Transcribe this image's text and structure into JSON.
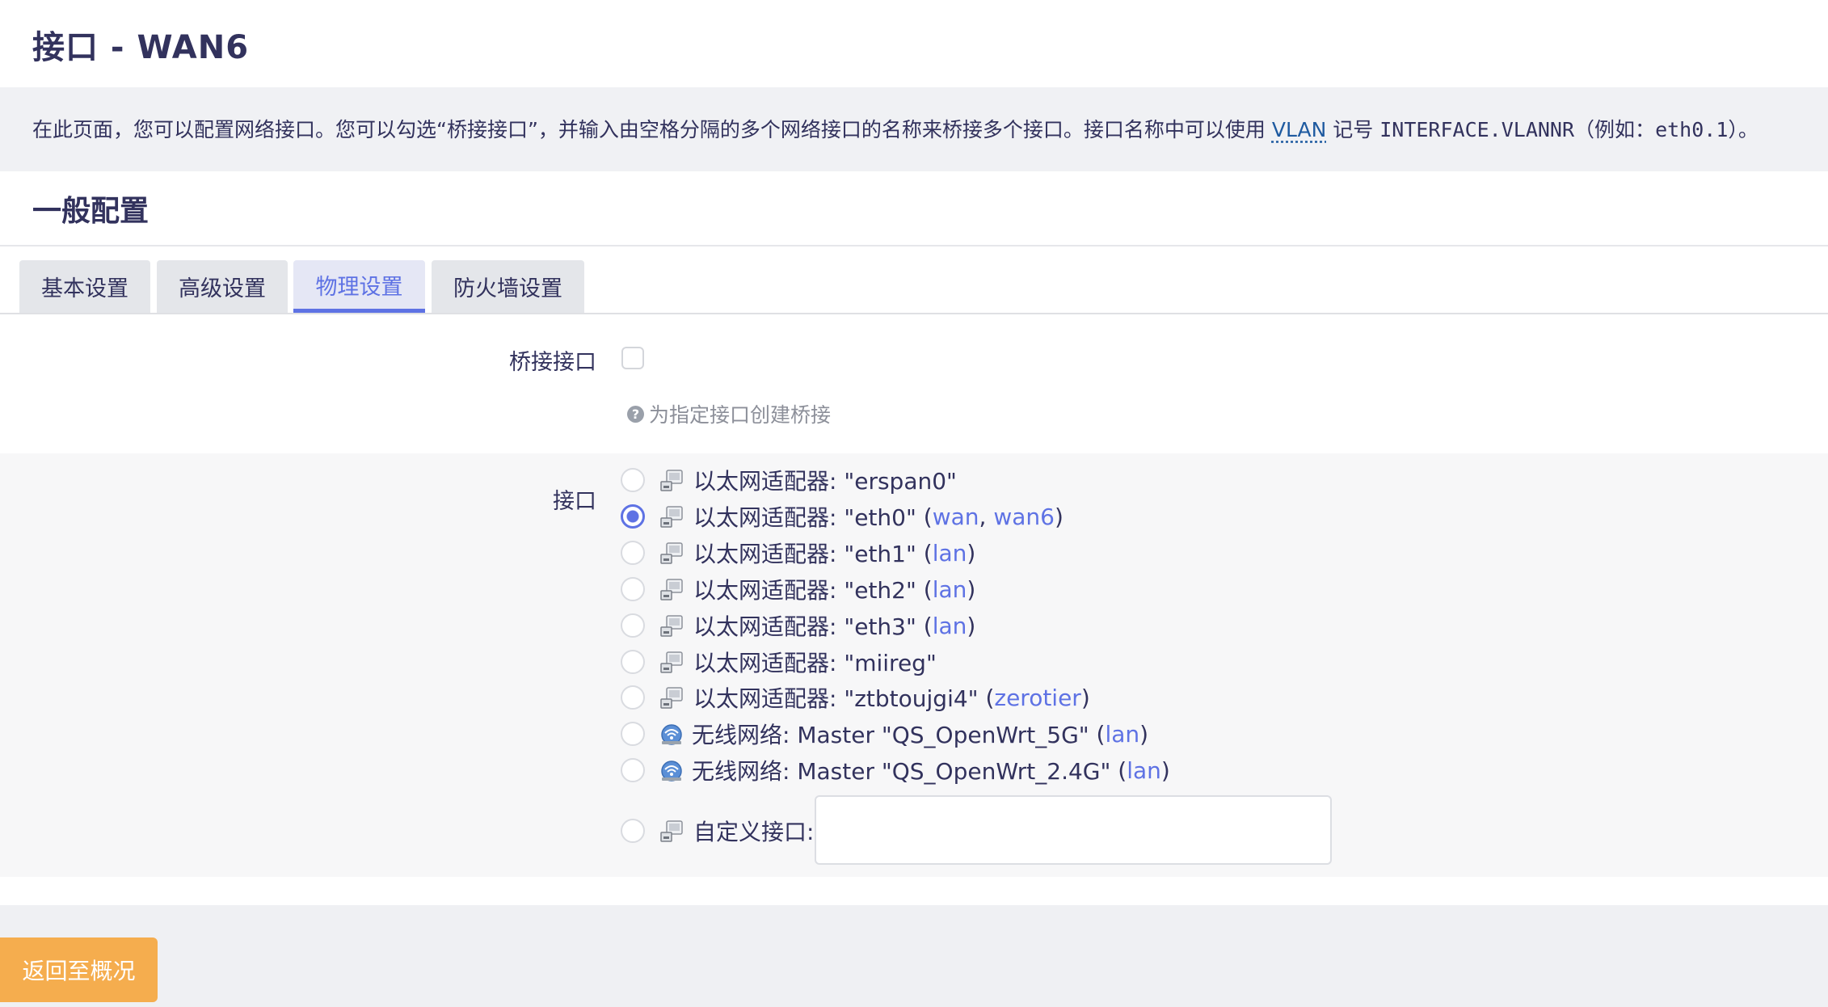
{
  "page": {
    "title": "接口 - WAN6",
    "description_pre": "在此页面，您可以配置网络接口。您可以勾选“桥接接口”，并输入由空格分隔的多个网络接口的名称来桥接多个接口。接口名称中可以使用",
    "description_link": "VLAN",
    "description_mid": "记号",
    "description_code1": "INTERFACE.VLANNR",
    "description_mid2": "（例如：",
    "description_code2": "eth0.1",
    "description_post": "）。"
  },
  "section": {
    "title": "一般配置",
    "tabs": [
      {
        "label": "基本设置",
        "active": false
      },
      {
        "label": "高级设置",
        "active": false
      },
      {
        "label": "物理设置",
        "active": true
      },
      {
        "label": "防火墙设置",
        "active": false
      }
    ]
  },
  "bridge": {
    "label": "桥接接口",
    "checked": false,
    "hint": "为指定接口创建桥接",
    "hint_icon": "question-circle-icon"
  },
  "interface": {
    "label": "接口",
    "options": [
      {
        "text": "以太网适配器: \"erspan0\"",
        "icon": "ethernet-icon",
        "checked": false,
        "nets": []
      },
      {
        "text": "以太网适配器: \"eth0\"",
        "icon": "ethernet-icon",
        "checked": true,
        "nets": [
          "wan",
          "wan6"
        ]
      },
      {
        "text": "以太网适配器: \"eth1\"",
        "icon": "ethernet-icon",
        "checked": false,
        "nets": [
          "lan"
        ]
      },
      {
        "text": "以太网适配器: \"eth2\"",
        "icon": "ethernet-icon",
        "checked": false,
        "nets": [
          "lan"
        ]
      },
      {
        "text": "以太网适配器: \"eth3\"",
        "icon": "ethernet-icon",
        "checked": false,
        "nets": [
          "lan"
        ]
      },
      {
        "text": "以太网适配器: \"miireg\"",
        "icon": "ethernet-icon",
        "checked": false,
        "nets": []
      },
      {
        "text": "以太网适配器: \"ztbtoujgi4\"",
        "icon": "ethernet-icon",
        "checked": false,
        "nets": [
          "zerotier"
        ]
      },
      {
        "text": "无线网络: Master \"QS_OpenWrt_5G\"",
        "icon": "wifi-icon",
        "checked": false,
        "nets": [
          "lan"
        ]
      },
      {
        "text": "无线网络: Master \"QS_OpenWrt_2.4G\"",
        "icon": "wifi-icon",
        "checked": false,
        "nets": [
          "lan"
        ]
      }
    ],
    "custom_label": "自定义接口:",
    "custom_value": ""
  },
  "footer": {
    "back_label": "返回至概况"
  },
  "colors": {
    "accent": "#5e72e4",
    "back_button": "#f5ad4e",
    "text": "#32325d"
  }
}
